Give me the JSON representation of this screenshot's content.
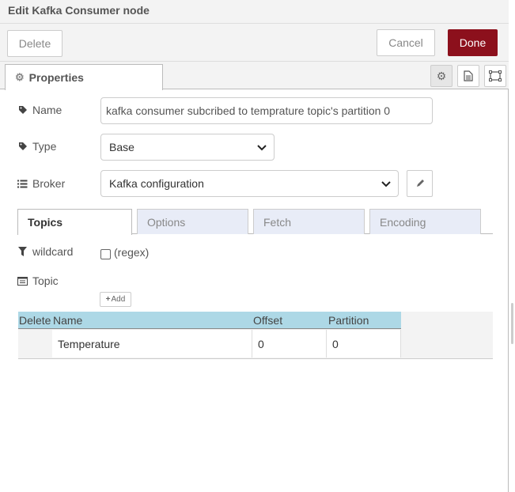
{
  "header": {
    "title": "Edit Kafka Consumer node"
  },
  "toolbar": {
    "delete_label": "Delete",
    "cancel_label": "Cancel",
    "done_label": "Done",
    "done_color": "#8c101c"
  },
  "tabs": {
    "properties_label": "Properties"
  },
  "form": {
    "name_label": "Name",
    "name_value": "kafka consumer subcribed to temprature topic's partition 0",
    "type_label": "Type",
    "type_value": "Base",
    "broker_label": "Broker",
    "broker_value": "Kafka configuration"
  },
  "subtabs": [
    {
      "label": "Topics",
      "active": true
    },
    {
      "label": "Options",
      "active": false
    },
    {
      "label": "Fetch",
      "active": false
    },
    {
      "label": "Encoding",
      "active": false
    }
  ],
  "topics": {
    "wildcard_label": "wildcard",
    "wildcard_checked": false,
    "regex_label": "(regex)",
    "topic_label": "Topic",
    "add_label": "Add",
    "columns": [
      "Delete",
      "Name",
      "Offset",
      "Partition"
    ],
    "rows": [
      {
        "name": "Temperature",
        "offset": "0",
        "partition": "0"
      }
    ],
    "header_color": "#add8e6"
  }
}
